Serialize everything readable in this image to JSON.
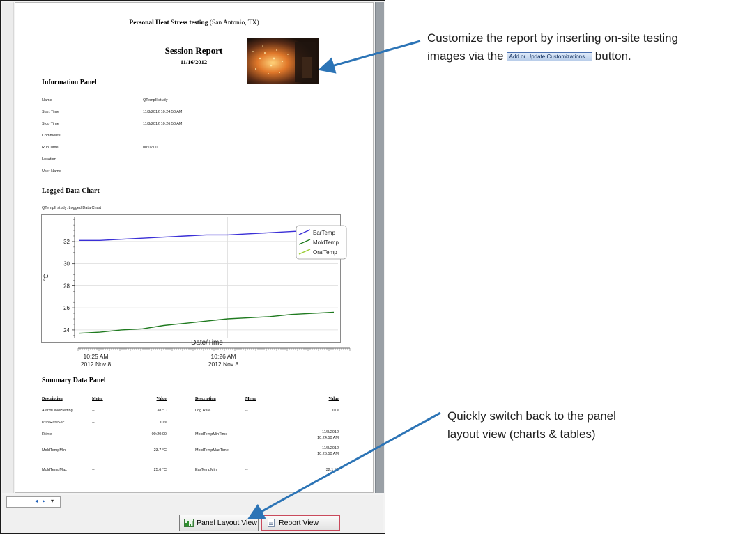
{
  "report": {
    "title_bold": "Personal Heat Stress testing",
    "title_rest": " (San Antonio, TX)",
    "session_title": "Session Report",
    "session_date": "11/16/2012",
    "information_panel": {
      "heading": "Information Panel",
      "rows": [
        {
          "label": "Name",
          "value": "QTempII study"
        },
        {
          "label": "Start Time",
          "value": "11/8/2012 10:24:50 AM"
        },
        {
          "label": "Stop Time",
          "value": "11/8/2012 10:26:50 AM"
        },
        {
          "label": "Comments",
          "value": ""
        },
        {
          "label": "Run Time",
          "value": "00:02:00"
        },
        {
          "label": "Location",
          "value": ""
        },
        {
          "label": "User Name",
          "value": ""
        }
      ]
    },
    "chart_section": {
      "heading": "Logged Data Chart",
      "subtitle": "QTempII study: Logged Data Chart"
    },
    "summary_panel": {
      "heading": "Summary Data Panel",
      "columns": [
        "Description",
        "Meter",
        "Value",
        "Description",
        "Meter",
        "Value"
      ],
      "rows": [
        [
          "AlarmLevelSetting",
          "--",
          "38 °C",
          "Log Rate",
          "--",
          "10 s"
        ],
        [
          "PrintRateSec",
          "--",
          "10 s",
          "",
          "",
          ""
        ],
        [
          "Rtime",
          "--",
          "00:20:00",
          "MoldTempMinTime",
          "--",
          "11/8/2012 10:24:50 AM"
        ],
        [
          "MoldTempMin",
          "--",
          "23.7 °C",
          "MoldTempMaxTime",
          "--",
          "11/8/2012 10:26:50 AM"
        ],
        [
          "MoldTempMax",
          "--",
          "25.6 °C",
          "EarTempMin",
          "--",
          "32.1 °C"
        ]
      ]
    }
  },
  "chart_data": {
    "type": "line",
    "title": "",
    "xlabel": "Date/Time",
    "ylabel": "°C",
    "x_tick_labels": [
      {
        "time": "10:25 AM",
        "date": "2012 Nov 8"
      },
      {
        "time": "10:26 AM",
        "date": "2012 Nov 8"
      }
    ],
    "x": [
      "10:24:50",
      "10:25:00",
      "10:25:10",
      "10:25:20",
      "10:25:30",
      "10:25:40",
      "10:25:50",
      "10:26:00",
      "10:26:10",
      "10:26:20",
      "10:26:30",
      "10:26:40",
      "10:26:50"
    ],
    "ylim": [
      23.3,
      34.2
    ],
    "y_ticks": [
      24,
      26,
      28,
      30,
      32
    ],
    "grid": true,
    "legend_position": "top-right",
    "series": [
      {
        "name": "EarTemp",
        "color": "#3a2fd6",
        "values": [
          32.1,
          32.1,
          32.2,
          32.3,
          32.4,
          32.5,
          32.6,
          32.6,
          32.7,
          32.8,
          32.9,
          33.0,
          33.1
        ]
      },
      {
        "name": "MoldTemp",
        "color": "#1f7a1f",
        "values": [
          23.7,
          23.8,
          24.0,
          24.1,
          24.4,
          24.6,
          24.8,
          25.0,
          25.1,
          25.2,
          25.4,
          25.5,
          25.6
        ]
      },
      {
        "name": "OralTemp",
        "color": "#9acd32",
        "values": []
      }
    ]
  },
  "footer": {
    "panel_layout_button": "Panel Layout View",
    "report_view_button": "Report View",
    "pager_prev": "◂",
    "pager_next": "▸",
    "pager_menu": "▾"
  },
  "annotations": {
    "top_line1": "Customize the report by inserting on-site testing",
    "top_line2_pre": "images via the",
    "top_button": "Add or Update Customizations...",
    "top_line2_post": "button.",
    "bottom_line1": "Quickly switch back to the panel",
    "bottom_line2": "layout view (charts & tables)"
  }
}
